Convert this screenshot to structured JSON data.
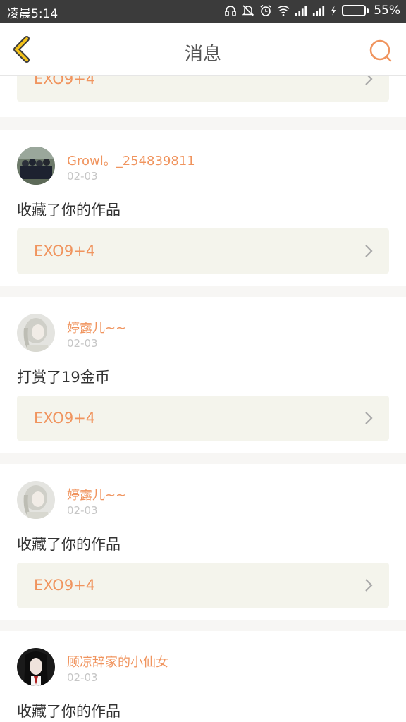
{
  "status_bar": {
    "time": "凌晨5:14",
    "battery_percent": "55%",
    "battery_level": 0.55,
    "icons": [
      "headphones-icon",
      "mute-bell-icon",
      "alarm-icon",
      "wifi-icon",
      "signal-icon",
      "signal-icon",
      "charging-icon",
      "battery-icon"
    ]
  },
  "navbar": {
    "title": "消息",
    "back_icon": "chevron-left-icon",
    "search_icon": "search-icon"
  },
  "colors": {
    "accent": "#f0945e",
    "back_arrow": "#f4c21a",
    "status_bar_bg": "#3b3b3b",
    "link_bg": "#f4f4ec"
  },
  "messages": [
    {
      "work_title": "EXO9+4"
    },
    {
      "username": "Growl。_254839811",
      "date": "02-03",
      "action": "收藏了你的作品",
      "work_title": "EXO9+4"
    },
    {
      "username": "婷露儿~~",
      "date": "02-03",
      "action": "打赏了19金币",
      "work_title": "EXO9+4"
    },
    {
      "username": "婷露儿~~",
      "date": "02-03",
      "action": "收藏了你的作品",
      "work_title": "EXO9+4"
    },
    {
      "username": "顾凉辞家的小仙女",
      "date": "02-03",
      "action": "收藏了你的作品"
    }
  ]
}
